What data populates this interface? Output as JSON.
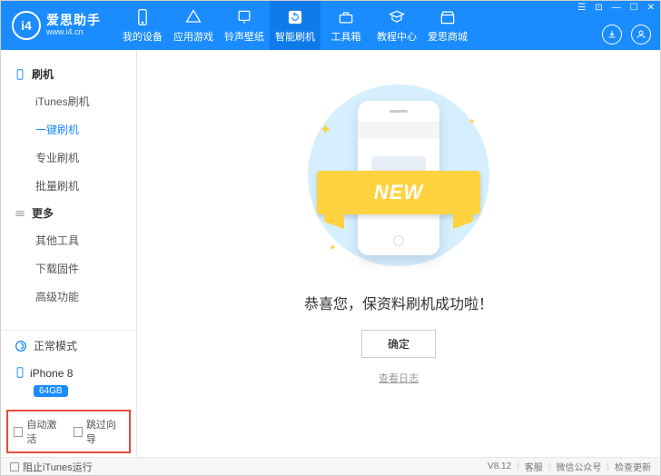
{
  "logo": {
    "abbr": "i4",
    "title": "爱思助手",
    "site": "www.i4.cn"
  },
  "nav": {
    "items": [
      {
        "label": "我的设备"
      },
      {
        "label": "应用游戏"
      },
      {
        "label": "铃声壁纸"
      },
      {
        "label": "智能刷机"
      },
      {
        "label": "工具箱"
      },
      {
        "label": "教程中心"
      },
      {
        "label": "爱思商城"
      }
    ]
  },
  "sidebar": {
    "group1": {
      "title": "刷机",
      "items": [
        "iTunes刷机",
        "一键刷机",
        "专业刷机",
        "批量刷机"
      ]
    },
    "group2": {
      "title": "更多",
      "items": [
        "其他工具",
        "下载固件",
        "高级功能"
      ]
    },
    "mode": "正常模式",
    "device": {
      "name": "iPhone 8",
      "storage": "64GB"
    },
    "checks": {
      "auto_activate": "自动激活",
      "skip_guide": "跳过向导"
    }
  },
  "main": {
    "ribbon": "NEW",
    "success": "恭喜您，保资料刷机成功啦！",
    "confirm": "确定",
    "log_link": "查看日志"
  },
  "footer": {
    "block_itunes": "阻止iTunes运行",
    "version": "V8.12",
    "service": "客服",
    "wechat": "微信公众号",
    "update": "检查更新"
  }
}
